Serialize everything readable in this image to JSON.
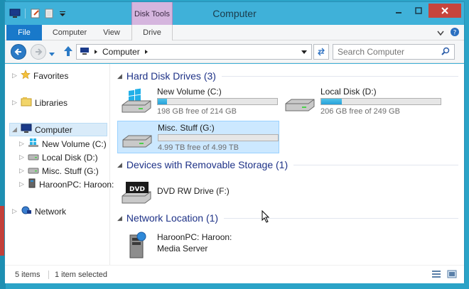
{
  "window": {
    "title": "Computer",
    "contextual_tab_group": "Disk Tools",
    "accent_color": "#3fb1d9",
    "close_color": "#c7453c"
  },
  "ribbon": {
    "tabs": [
      {
        "label": "File",
        "active": true
      },
      {
        "label": "Computer"
      },
      {
        "label": "View"
      },
      {
        "label": "Drive"
      }
    ]
  },
  "address": {
    "path": "Computer",
    "search_placeholder": "Search Computer"
  },
  "nav_tree": {
    "items": [
      {
        "label": "Favorites",
        "icon": "star-icon"
      },
      {
        "label": "Libraries",
        "icon": "libraries-icon"
      },
      {
        "label": "Computer",
        "icon": "computer-icon",
        "selected": true
      },
      {
        "label": "New Volume (C:)",
        "icon": "windows-drive-icon"
      },
      {
        "label": "Local Disk (D:)",
        "icon": "hard-drive-icon"
      },
      {
        "label": "Misc. Stuff (G:)",
        "icon": "hard-drive-icon"
      },
      {
        "label": "HaroonPC: Haroon:",
        "icon": "media-server-icon"
      },
      {
        "label": "Network",
        "icon": "network-icon"
      }
    ]
  },
  "groups": {
    "hard_disks": {
      "title": "Hard Disk Drives (3)",
      "drives": [
        {
          "name": "New Volume (C:)",
          "free": "198 GB free of 214 GB",
          "used_fraction": 0.075
        },
        {
          "name": "Local Disk (D:)",
          "free": "206 GB free of 249 GB",
          "used_fraction": 0.17
        },
        {
          "name": "Misc. Stuff (G:)",
          "free": "4.99 TB free of 4.99 TB",
          "used_fraction": 0.0
        }
      ]
    },
    "removable": {
      "title": "Devices with Removable Storage (1)",
      "items": [
        {
          "name": "DVD RW Drive (F:)",
          "icon_text": "DVD"
        }
      ]
    },
    "network": {
      "title": "Network Location (1)",
      "items": [
        {
          "name": "HaroonPC: Haroon:",
          "sub": "Media Server"
        }
      ]
    }
  },
  "status": {
    "items": "5 items",
    "selected": "1 item selected"
  }
}
